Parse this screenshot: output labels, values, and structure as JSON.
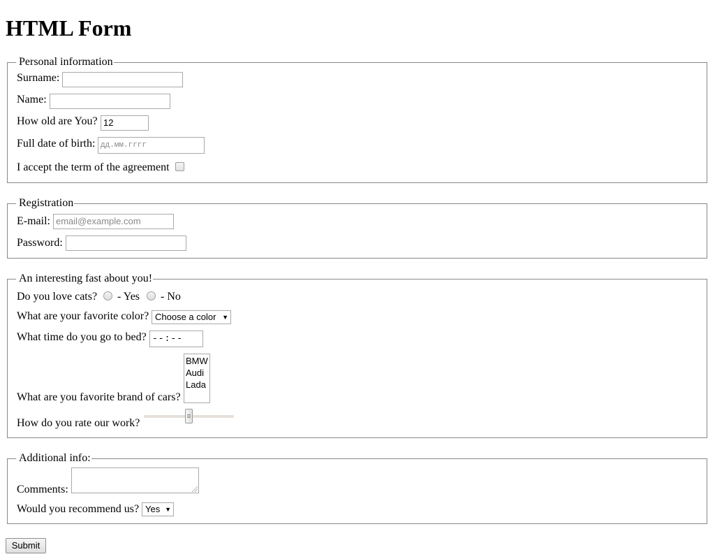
{
  "page": {
    "title": "HTML Form"
  },
  "personal": {
    "legend": "Personal information",
    "surname_label": "Surname:",
    "surname_value": "",
    "name_label": "Name:",
    "name_value": "",
    "age_label": "How old are You?",
    "age_value": "12",
    "dob_label": "Full date of birth:",
    "dob_placeholder": "дд.мм.гггг",
    "agree_label": "I accept the term of the agreement",
    "agree_checked": false
  },
  "registration": {
    "legend": "Registration",
    "email_label": "E-mail:",
    "email_placeholder": "email@example.com",
    "password_label": "Password:",
    "password_value": ""
  },
  "fact": {
    "legend": "An interesting fast about you!",
    "cats_label": "Do you love cats?",
    "cats_yes": "- Yes",
    "cats_no": "- No",
    "color_label": "What are your favorite color?",
    "color_selected": "Choose a color",
    "bed_label": "What time do you go to bed?",
    "bed_placeholder": "--:--",
    "cars_label": "What are you favorite brand of cars?",
    "cars_options": [
      "BMW",
      "Audi",
      "Lada"
    ],
    "rate_label": "How do you rate our work?",
    "rate_value": 50,
    "rate_min": 0,
    "rate_max": 100
  },
  "additional": {
    "legend": "Additional info:",
    "comments_label": "Comments:",
    "comments_value": "",
    "recommend_label": "Would you recommend us?",
    "recommend_selected": "Yes"
  },
  "actions": {
    "submit_label": "Submit"
  },
  "icons": {
    "select_arrow": "triangle-down-icon"
  }
}
